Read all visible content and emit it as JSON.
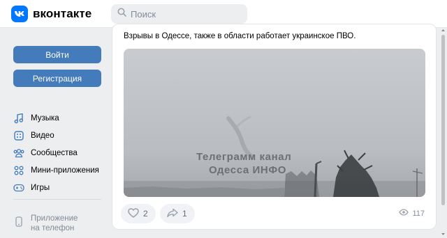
{
  "header": {
    "brand": "вконтакте",
    "search_placeholder": "Поиск"
  },
  "sidebar": {
    "login_label": "Войти",
    "register_label": "Регистрация",
    "menu": [
      {
        "label": "Музыка",
        "icon": "music-icon"
      },
      {
        "label": "Видео",
        "icon": "video-icon"
      },
      {
        "label": "Сообщества",
        "icon": "communities-icon"
      },
      {
        "label": "Мини-приложения",
        "icon": "mini-apps-icon"
      },
      {
        "label": "Игры",
        "icon": "games-icon"
      }
    ],
    "app_promo": {
      "line1": "Приложение",
      "line2": "на телефон",
      "icon": "phone-icon"
    }
  },
  "post": {
    "text": "Взрывы в Одессе, также в области работает украинское ПВО.",
    "photo_watermark_line1": "Телеграмм  канал",
    "photo_watermark_line2": "Одесса ИНФО",
    "likes": "2",
    "shares": "1",
    "views": "117"
  },
  "colors": {
    "brand": "#0077ff",
    "button": "#447bba",
    "background": "#edeef0",
    "muted_text": "#818c99"
  }
}
